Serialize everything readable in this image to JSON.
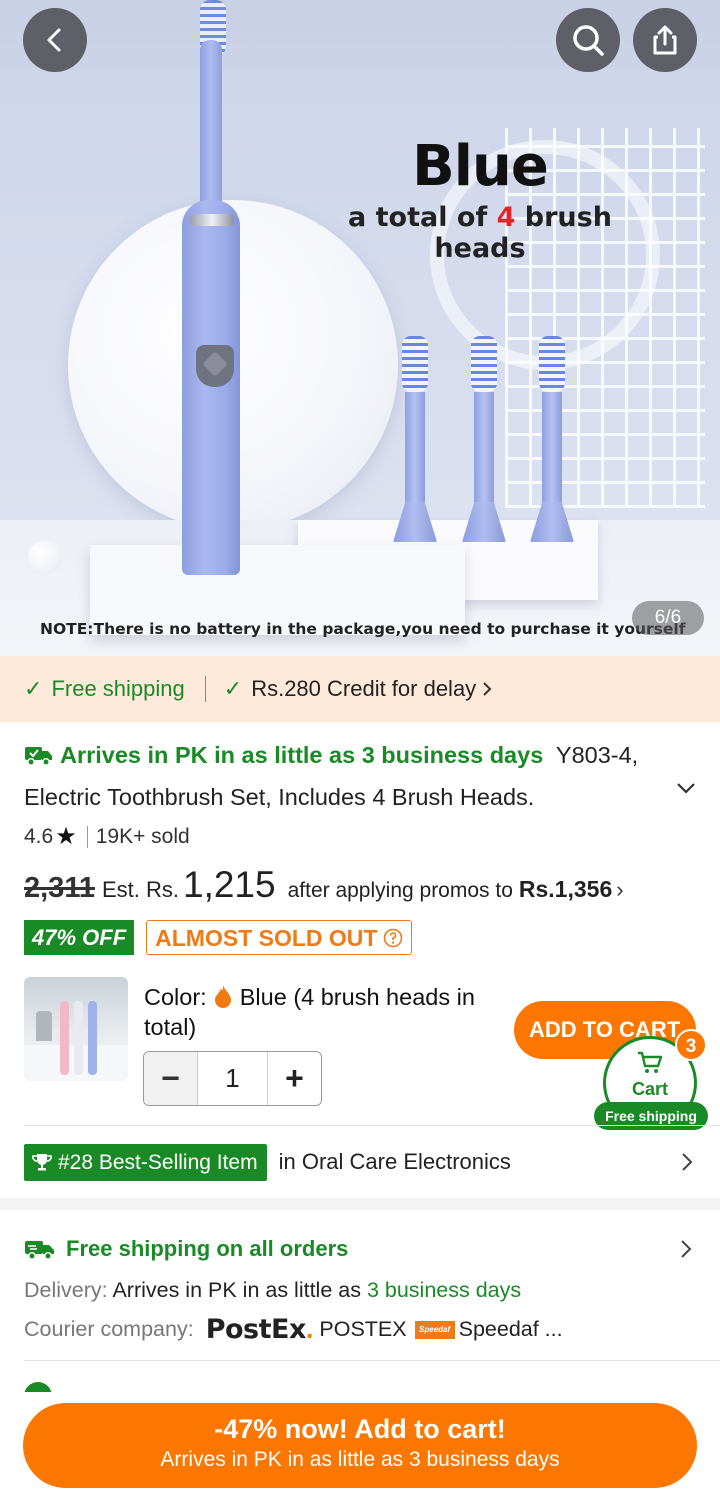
{
  "gallery": {
    "image_title": "Blue",
    "image_subtitle_pre": "a total of ",
    "image_subtitle_num": "4",
    "image_subtitle_post": " brush heads",
    "image_note": "NOTE:There is no battery in the package,you need to purchase it yourself",
    "page_counter": "6/6"
  },
  "header_icons": [
    "back-arrow-icon",
    "search-icon",
    "share-icon"
  ],
  "shipping_strip": {
    "free_shipping": "Free shipping",
    "credit": "Rs.280 Credit for delay"
  },
  "product": {
    "arrival": "Arrives in PK in as little as 3 business days",
    "title": "Y803-4, Electric Toothbrush Set, Includes 4 Brush Heads.",
    "rating": "4.6",
    "sold": "19K+ sold",
    "old_price": "2,311",
    "est_label": "Est. Rs.",
    "est_price": "1,215",
    "after_promo": "after applying promos to",
    "promo_price": "Rs.1,356",
    "discount_badge": "47% OFF",
    "stock_badge": "ALMOST SOLD OUT"
  },
  "variant": {
    "color_label": "Color:",
    "color_value": "Blue (4 brush heads in total)",
    "quantity": "1",
    "minus": "−",
    "plus": "+"
  },
  "cart": {
    "add_to_cart": "ADD TO CART",
    "cart_label": "Cart",
    "cart_count": "3",
    "free_shipping": "Free shipping"
  },
  "bestseller": {
    "rank": "#28 Best-Selling Item",
    "category": "in Oral Care Electronics"
  },
  "shipping_info": {
    "title": "Free shipping on all orders",
    "delivery_label": "Delivery:",
    "delivery_text": "Arrives in PK in as little as",
    "delivery_days": "3 business days",
    "courier_label": "Courier company:",
    "courier_logo": "PostEx",
    "courier_1": "POSTEX",
    "speedaf_logo": "Speedaf",
    "courier_2": "Speedaf ..."
  },
  "bottom_bar": {
    "line1": "-47% now! Add to cart!",
    "line2": "Arrives in PK in as little as 3 business days"
  },
  "colors": {
    "accent_orange": "#fb7701",
    "green": "#1a8a26",
    "strip_bg": "#fdeadb"
  }
}
